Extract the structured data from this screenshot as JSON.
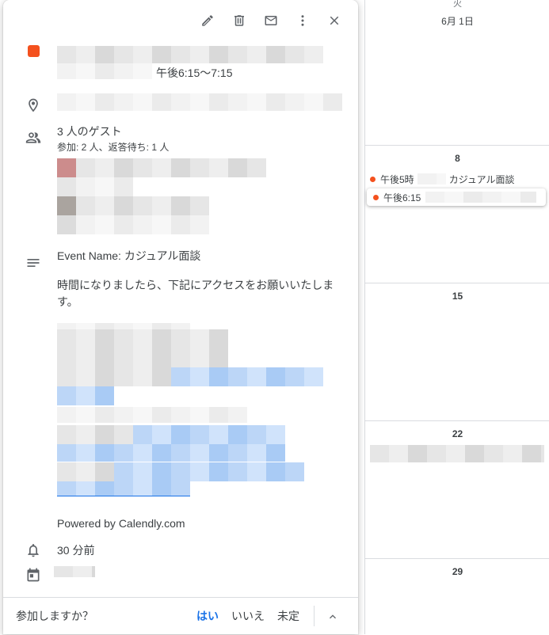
{
  "calendar": {
    "header": {
      "weekday": "火",
      "date": "6月 1日"
    },
    "weeks": [
      {
        "num": "8",
        "events": [
          {
            "time": "午後5時",
            "title": "カジュアル面談"
          },
          {
            "time": "午後6:15"
          }
        ]
      },
      {
        "num": "15"
      },
      {
        "num": "22"
      },
      {
        "num": "29"
      }
    ]
  },
  "event": {
    "time_range": "午後6:15〜7:15",
    "guests": {
      "summary": "3 人のゲスト",
      "status": "参加: 2 人、返答待ち: 1 人"
    },
    "description": {
      "event_name": "Event Name: カジュアル面談",
      "body": "時間になりましたら、下記にアクセスをお願いいたします。",
      "powered_by": "Powered by Calendly.com"
    },
    "reminder": "30 分前"
  },
  "rsvp": {
    "question": "参加しますか？",
    "yes": "はい",
    "no": "いいえ",
    "maybe": "未定"
  },
  "colors": {
    "event_color": "#f4511e",
    "accent": "#1a73e8"
  },
  "icons": [
    "edit-icon",
    "delete-icon",
    "email-icon",
    "more-vert-icon",
    "close-icon",
    "location-pin-icon",
    "guests-icon",
    "description-icon",
    "bell-icon",
    "calendar-icon",
    "chevron-up-icon"
  ]
}
